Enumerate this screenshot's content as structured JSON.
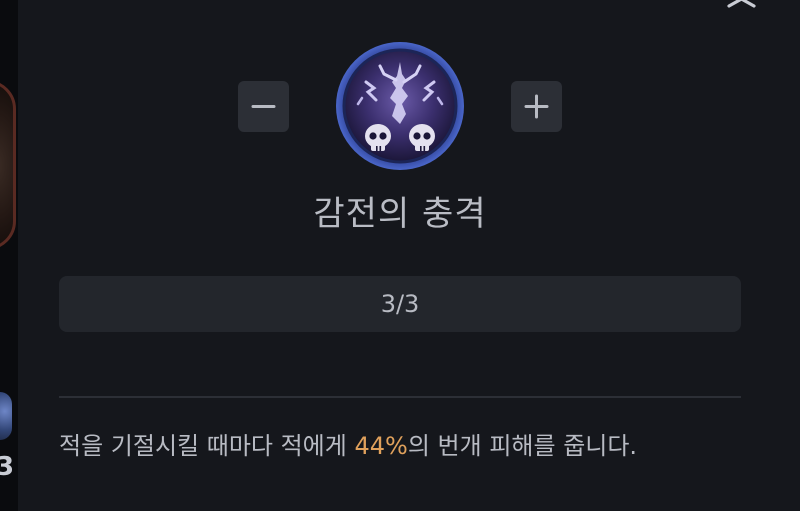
{
  "skill": {
    "name": "감전의 충격",
    "rank": "3/3",
    "icon": "lightning-skulls-icon"
  },
  "controls": {
    "decrease_icon": "minus-icon",
    "increase_icon": "plus-icon",
    "close_icon": "close-icon"
  },
  "description": {
    "before": "적을 기절시킬 때마다 적에게 ",
    "value": "44%",
    "after": "의 번개 피해를 줍니다."
  },
  "background": {
    "edge_number": "3"
  },
  "colors": {
    "background": "#15171c",
    "button": "#2c2f36",
    "rank_box": "#23262c",
    "text": "#b8bbc3",
    "highlight": "#e0a15c",
    "icon_ring": "#3d4fb0"
  }
}
